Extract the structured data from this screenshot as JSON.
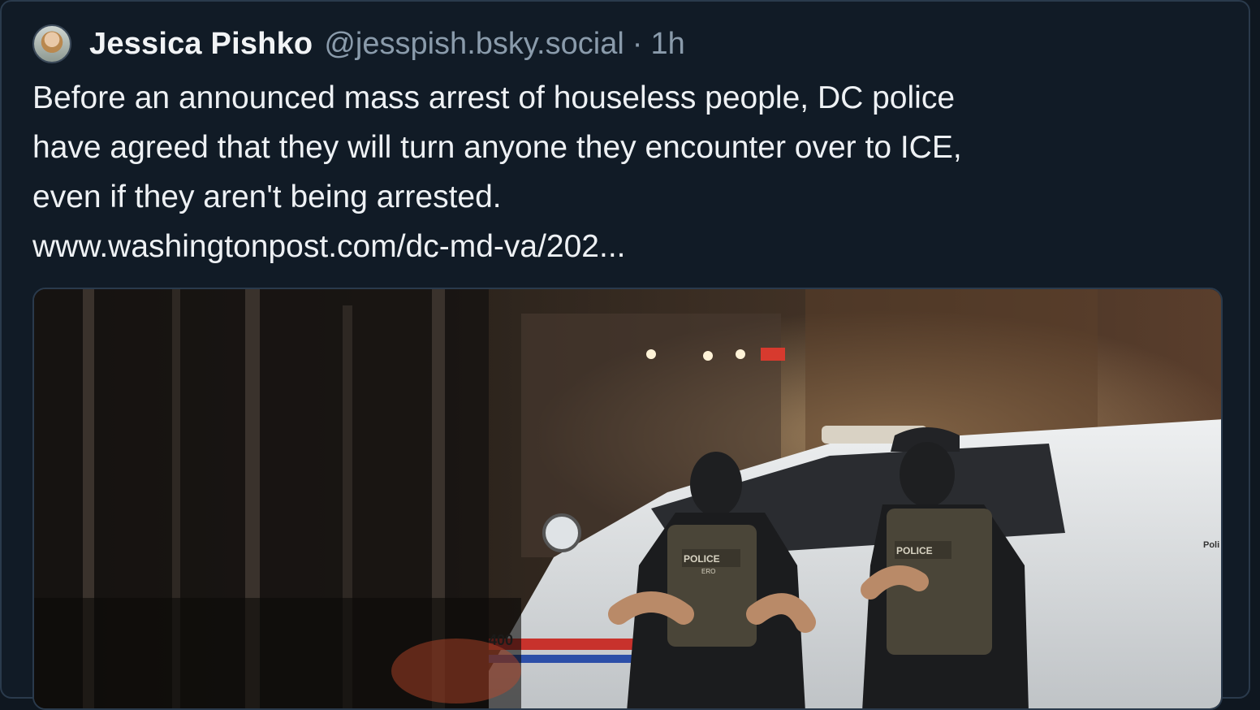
{
  "post": {
    "author": {
      "display_name": "Jessica Pishko",
      "handle": "@jesspish.bsky.social",
      "separator": "·",
      "timestamp": "1h"
    },
    "text_lines": [
      "Before an announced mass arrest of houseless people, DC police",
      "have agreed that they will turn anyone they encounter over to ICE,",
      "even if they aren't being arrested."
    ],
    "link": "www.washingtonpost.com/dc-md-va/202...",
    "image": {
      "vest_label_1": "POLICE",
      "vest_label_1_sub": "ERO",
      "vest_label_2": "POLICE",
      "car_number": "400",
      "car_side_text": "Poli"
    }
  },
  "colors": {
    "background": "#0f1720",
    "card": "#111b26",
    "border": "#2a3a4c",
    "text": "#eef1f4",
    "muted": "#8a9bab"
  }
}
